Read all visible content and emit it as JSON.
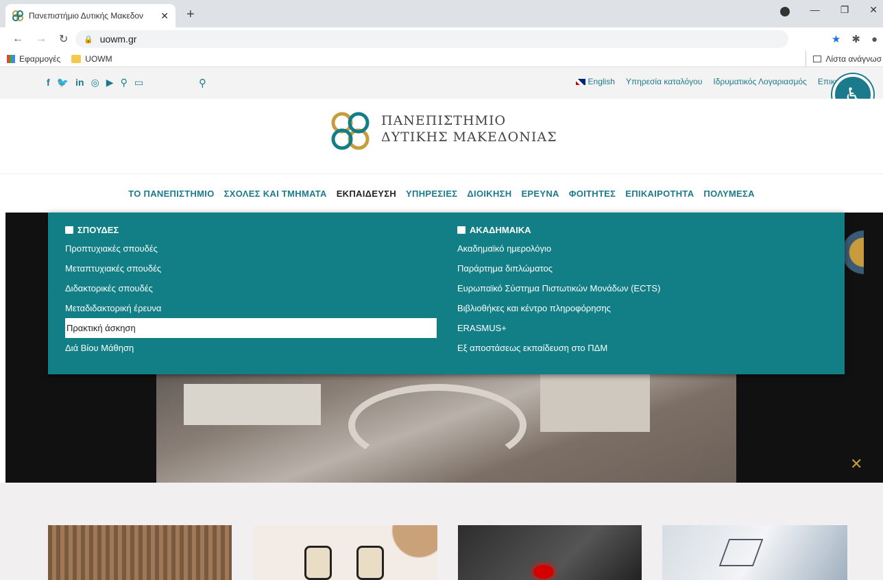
{
  "browser": {
    "tab_title": "Πανεπιστήμιο Δυτικής Μακεδον",
    "tab_close": "✕",
    "new_tab": "+",
    "url": "uowm.gr",
    "bookmarks": [
      "Εφαρμογές",
      "UOWM"
    ],
    "reading_list": "Λίστα ανάγνωσ"
  },
  "topbar": {
    "social_icons": [
      "facebook-icon",
      "twitter-icon",
      "linkedin-icon",
      "instagram-icon",
      "youtube-icon",
      "location-icon",
      "tv-icon"
    ],
    "links": [
      "English",
      "Υπηρεσία καταλόγου",
      "Ιδρυματικός Λογαριασμός",
      "Επικοινωνία"
    ]
  },
  "logo": {
    "line1": "ΠΑΝΕΠΙΣΤΗΜΙΟ",
    "line2": "ΔΥΤΙΚΗΣ ΜΑΚΕΔΟΝΙΑΣ"
  },
  "menu": {
    "items": [
      "ΤΟ ΠΑΝΕΠΙΣΤΗΜΙΟ",
      "ΣΧΟΛΕΣ ΚΑΙ ΤΜΗΜΑΤΑ",
      "ΕΚΠΑΙΔΕΥΣΗ",
      "ΥΠΗΡΕΣΙΕΣ",
      "ΔΙΟΙΚΗΣΗ",
      "ΕΡΕΥΝΑ",
      "ΦΟΙΤΗΤΕΣ",
      "ΕΠΙΚΑΙΡΟΤΗΤΑ",
      "ΠΟΛΥΜΕΣΑ"
    ],
    "active_index": 2
  },
  "dropdown": {
    "left": {
      "heading": "ΣΠΟΥΔΕΣ",
      "items": [
        "Προπτυχιακές σπουδές",
        "Μεταπτυχιακές σπουδές",
        "Διδακτορικές σπουδές",
        "Μεταδιδακτορική έρευνα",
        "Πρακτική άσκηση",
        "Διά Βίου Μάθηση"
      ],
      "highlighted_index": 4
    },
    "right": {
      "heading": "ΑΚΑΔΗΜΑΙΚΑ",
      "items": [
        "Ακαδημαϊκό ημερολόγιο",
        "Παράρτημα διπλώματος",
        "Ευρωπαϊκό Σύστημα Πιστωτικών Μονάδων (ECTS)",
        "Βιβλιοθήκες και κέντρο πληροφόρησης",
        "ERASMUS+",
        "Εξ αποστάσεως εκπαίδευση στο ΠΔΜ"
      ]
    }
  },
  "colors": {
    "brand_teal": "#127f87",
    "link_teal": "#1b7a8c",
    "gold": "#c89b3c"
  }
}
